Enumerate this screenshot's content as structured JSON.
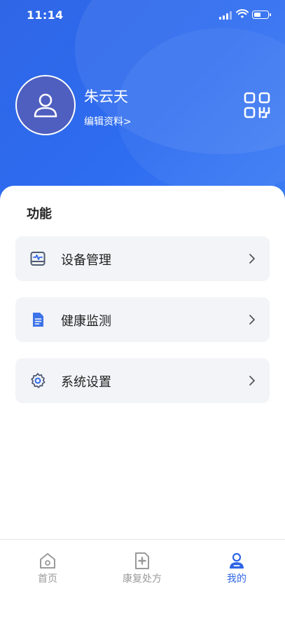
{
  "status_bar": {
    "time": "11:14"
  },
  "profile": {
    "name": "朱云天",
    "edit_label": "编辑资料>"
  },
  "features": {
    "title": "功能",
    "items": [
      {
        "label": "设备管理",
        "icon": "device-monitor-icon"
      },
      {
        "label": "健康监测",
        "icon": "document-icon"
      },
      {
        "label": "系统设置",
        "icon": "gear-icon"
      }
    ]
  },
  "tabbar": {
    "tabs": [
      {
        "label": "首页",
        "icon": "home-icon",
        "active": false
      },
      {
        "label": "康复处方",
        "icon": "prescription-icon",
        "active": false
      },
      {
        "label": "我的",
        "icon": "user-icon",
        "active": true
      }
    ]
  },
  "colors": {
    "primary": "#2f66e6",
    "inactive": "#9a9a9a",
    "card_bg": "#f2f4f7"
  }
}
